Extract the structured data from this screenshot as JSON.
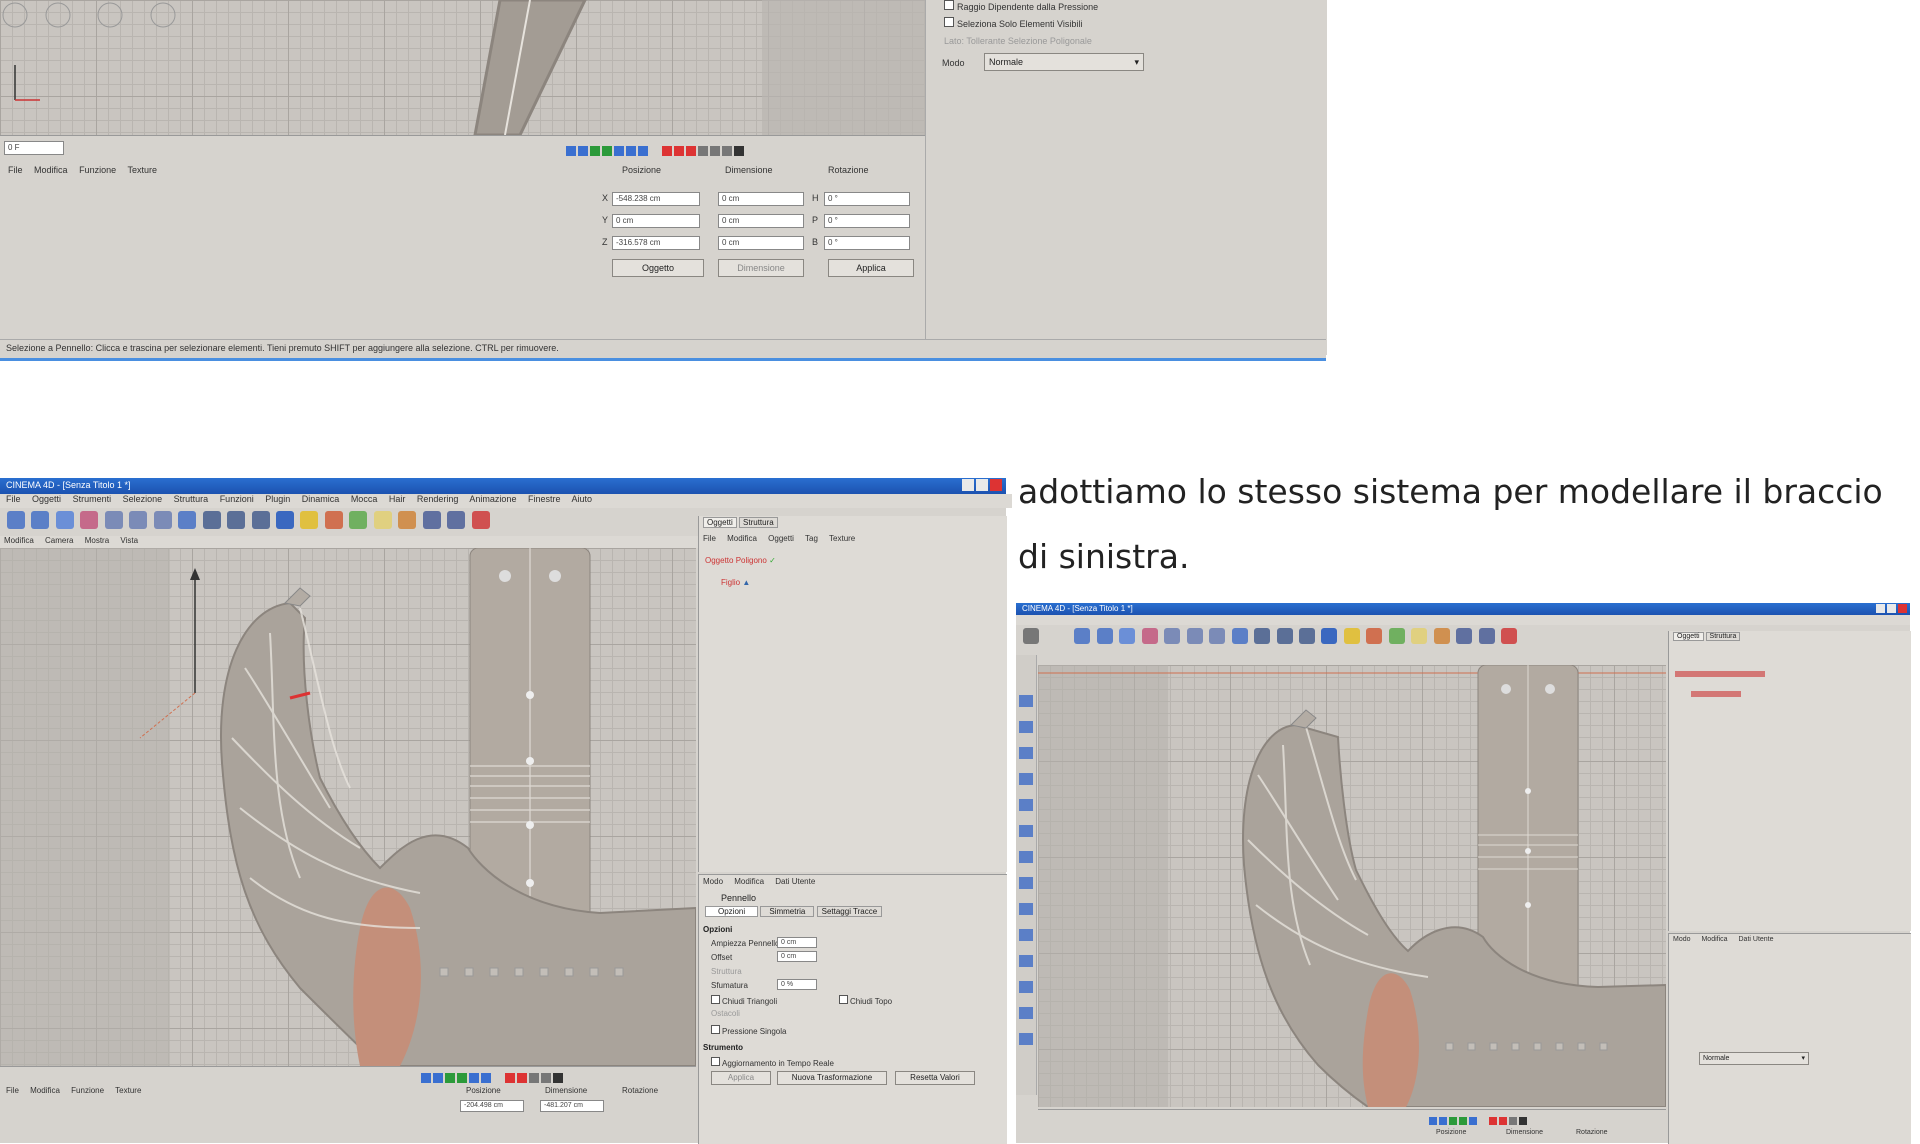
{
  "top_window": {
    "options": {
      "opt1": "Raggio Dipendente dalla Pressione",
      "opt2": "Seleziona Solo Elementi Visibili",
      "opt3": "Lato: Tollerante Selezione Poligonale",
      "mode_label": "Modo",
      "mode_value": "Normale"
    },
    "frame_field": "0 F",
    "bottom_menu": [
      "File",
      "Modifica",
      "Funzione",
      "Texture"
    ],
    "coords": {
      "headers": [
        "Posizione",
        "Dimensione",
        "Rotazione"
      ],
      "axis": [
        "X",
        "Y",
        "Z"
      ],
      "pos": [
        "-548.238 cm",
        "0 cm",
        "-316.578 cm"
      ],
      "size": [
        "0 cm",
        "0 cm",
        "0 cm"
      ],
      "rot_axis": [
        "H",
        "P",
        "B"
      ],
      "rot": [
        "0 °",
        "0 °",
        "0 °"
      ],
      "btn_object": "Oggetto",
      "btn_dimension": "Dimensione",
      "btn_apply": "Applica"
    },
    "status": "Selezione a Pennello: Clicca e trascina per selezionare elementi. Tieni premuto SHIFT per aggiungere alla selezione. CTRL per rimuovere."
  },
  "caption": {
    "line1": "adottiamo lo stesso sistema per modellare il braccio",
    "line2": "di sinistra."
  },
  "left_window": {
    "title": "CINEMA 4D - [Senza Titolo 1 *]",
    "menu": [
      "File",
      "Oggetti",
      "Strumenti",
      "Selezione",
      "Struttura",
      "Funzioni",
      "Plugin",
      "Dinamica",
      "Mocca",
      "Hair",
      "Rendering",
      "Animazione",
      "Finestre",
      "Aiuto"
    ],
    "view_menu": [
      "Modifica",
      "Camera",
      "Mostra",
      "Vista"
    ],
    "obj_tabs": [
      "Oggetti",
      "Struttura"
    ],
    "obj_menu": [
      "File",
      "Modifica",
      "Oggetti",
      "Tag",
      "Texture"
    ],
    "objects": [
      "Oggetto Poligono",
      "Figlio"
    ],
    "attr_menu": [
      "Modo",
      "Modifica",
      "Dati Utente"
    ],
    "attr_title": "Pennello",
    "attr_tabs": [
      "Opzioni",
      "Simmetria",
      "Settaggi Tracce"
    ],
    "opzioni_label": "Opzioni",
    "params": [
      "Ampiezza Pennello",
      "Offset",
      "Struttura",
      "Sfumatura",
      "Ostacoli"
    ],
    "param_values": [
      "0 cm",
      "0 cm",
      "0 %"
    ],
    "chk1": "Chiudi Triangoli",
    "chk2": "Chiudi Topo",
    "chk3": "Pressione Singola",
    "sec2": "Strumento",
    "realtime": "Aggiornamento in Tempo Reale",
    "btns": [
      "Applica",
      "Nuova Trasformazione",
      "Resetta Valori"
    ],
    "bottom_menu": [
      "File",
      "Modifica",
      "Funzione",
      "Texture"
    ],
    "coord_headers": [
      "Posizione",
      "Dimensione",
      "Rotazione"
    ],
    "coord_vals": [
      "-204.498 cm",
      "-481.207 cm"
    ]
  },
  "right_window": {
    "title": "CINEMA 4D - [Senza Titolo 1 *]",
    "obj_tabs": [
      "Oggetti",
      "Struttura"
    ],
    "attr_menu": [
      "Modo",
      "Modifica",
      "Dati Utente"
    ],
    "mode_value": "Normale",
    "coord_headers": [
      "Posizione",
      "Dimensione",
      "Rotazione"
    ]
  }
}
